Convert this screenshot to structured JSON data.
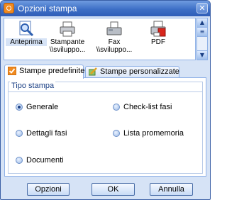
{
  "window": {
    "title": "Opzioni stampa",
    "close_glyph": "✕"
  },
  "printers": [
    {
      "icon": "preview-magnifier-icon",
      "line1": "Anteprima",
      "line2": ""
    },
    {
      "icon": "printer-icon",
      "line1": "Stampante",
      "line2": "\\\\sviluppo..."
    },
    {
      "icon": "fax-icon",
      "line1": "Fax",
      "line2": "\\\\sviluppo..."
    },
    {
      "icon": "pdf-printer-icon",
      "line1": "PDF",
      "line2": ""
    }
  ],
  "scrollbar": {
    "up": "▲",
    "mid": "≡",
    "down": "▼"
  },
  "tabs": [
    {
      "label": "Stampe predefinite",
      "active": true
    },
    {
      "label": "Stampe personalizzate",
      "active": false
    }
  ],
  "group": {
    "title": "Tipo stampa",
    "options": [
      {
        "label": "Generale",
        "checked": true
      },
      {
        "label": "Check-list fasi",
        "checked": false
      },
      {
        "label": "Dettagli fasi",
        "checked": false
      },
      {
        "label": "Lista promemoria",
        "checked": false
      },
      {
        "label": "Documenti",
        "checked": false
      }
    ]
  },
  "buttons": {
    "options": "Opzioni",
    "ok": "OK",
    "cancel": "Annulla"
  },
  "colors": {
    "title_bar": "#3d6fc6",
    "window_bg": "#d6e3f6",
    "accent": "#1a3f84",
    "border": "#8fb1e6"
  }
}
